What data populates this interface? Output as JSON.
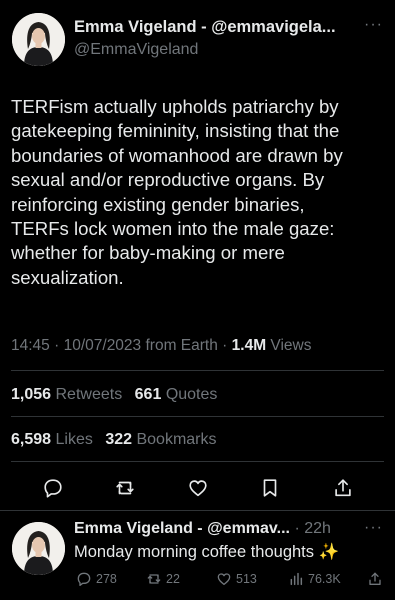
{
  "tweet": {
    "author_name": "Emma Vigeland - @emmavigela...",
    "handle": "@EmmaVigeland",
    "text": "TERFism actually upholds patriarchy by\ngatekeeping femininity, insisting that the\nboundaries of womanhood are drawn by\nsexual and/or reproductive organs. By\nreinforcing existing gender binaries,\nTERFs lock women into the male gaze:\nwhether for baby-making or mere\nsexualization.",
    "time": "14:45",
    "date": "10/07/2023",
    "source": "from Earth",
    "separator": "·",
    "views_count": "1.4M",
    "views_label": "Views",
    "more_icon": "···"
  },
  "stats": {
    "retweets_count": "1,056",
    "retweets_label": "Retweets",
    "quotes_count": "661",
    "quotes_label": "Quotes",
    "likes_count": "6,598",
    "likes_label": "Likes",
    "bookmarks_count": "322",
    "bookmarks_label": "Bookmarks"
  },
  "actions": [
    {
      "name": "reply",
      "icon": "reply-icon"
    },
    {
      "name": "retweet",
      "icon": "retweet-icon"
    },
    {
      "name": "like",
      "icon": "heart-icon"
    },
    {
      "name": "bookmark",
      "icon": "bookmark-icon"
    },
    {
      "name": "share",
      "icon": "share-icon"
    }
  ],
  "reply": {
    "author_name": "Emma Vigeland - @emmav...",
    "separator": "·",
    "time": "22h",
    "text": "Monday morning coffee thoughts",
    "emoji": "✨",
    "more_icon": "···",
    "reply_count": "278",
    "retweet_count": "22",
    "like_count": "513",
    "view_count": "76.3K"
  },
  "colors": {
    "background": "#000000",
    "text_primary": "#e7e9ea",
    "text_secondary": "#71767b",
    "divider": "#2f3336"
  }
}
